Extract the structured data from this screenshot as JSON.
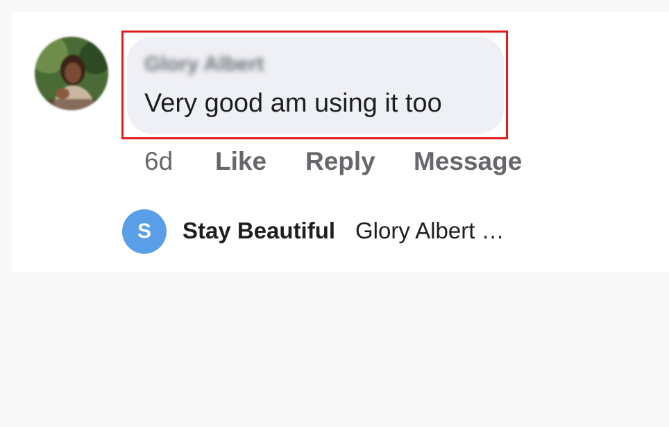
{
  "comment": {
    "author": "Glory Albert",
    "text": "Very good am using it too",
    "time": "6d",
    "actions": {
      "like": "Like",
      "reply": "Reply",
      "message": "Message"
    },
    "highlight_color": "#e01b1b",
    "bubble_color": "#eff0f5"
  },
  "reply_preview": {
    "avatar_letter": "S",
    "avatar_color": "#5b9ee8",
    "author": "Stay Beautiful",
    "snippet": "Glory Albert …"
  }
}
